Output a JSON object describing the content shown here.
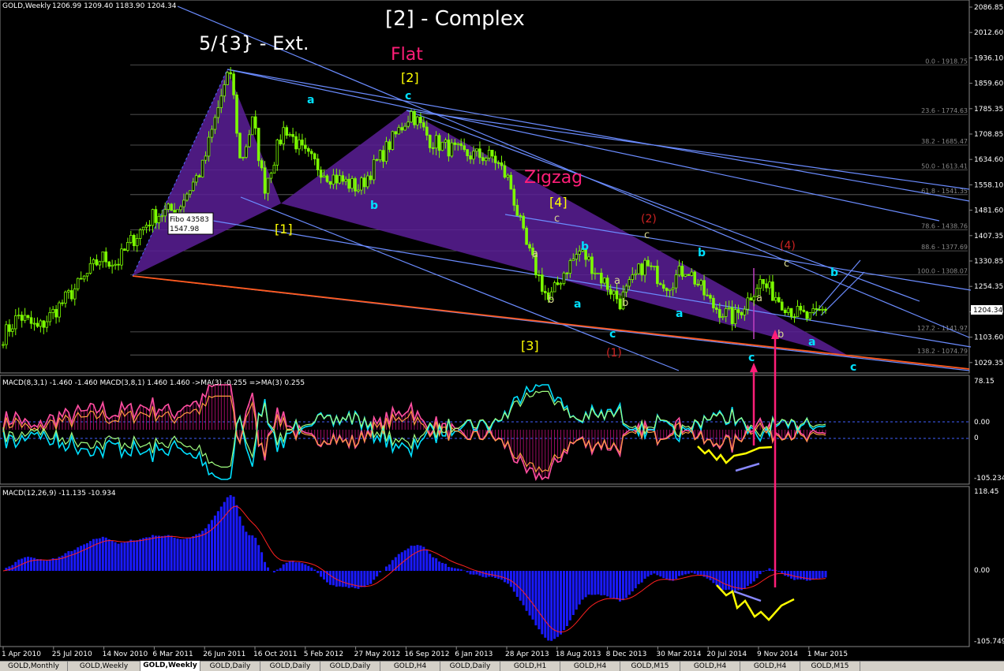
{
  "header": {
    "main": {
      "symbol": "GOLD,Weekly",
      "ohlc": "1206.99 1209.40 1183.90 1204.34"
    },
    "macd1": {
      "label": "MACD(8,3,1) -1.460 -1.460  MACD(3,8,1) 1.460 1.460  ->MA(3) -0.255  =>MA(3) 0.255"
    },
    "macd2": {
      "label": "MACD(12,26,9) -11.135 -10.934"
    }
  },
  "price_axis": {
    "ticks": [
      "2086.85",
      "2012.60",
      "1936.10",
      "1859.60",
      "1785.35",
      "1708.85",
      "1634.60",
      "1558.10",
      "1481.60",
      "1407.35",
      "1330.85",
      "1254.35",
      "1180.10",
      "1103.60",
      "1029.35"
    ],
    "current": "1204.34"
  },
  "macd1_axis": {
    "top": "78.15",
    "zero": "0.00",
    "zero2": "0",
    "bottom": "-105.234"
  },
  "macd2_axis": {
    "top": "118.45",
    "zero": "0.00",
    "bottom": "-105.749"
  },
  "fib_levels": [
    {
      "label": "0.0 - 1918.75",
      "price": 1918.75
    },
    {
      "label": "23.6 - 1774.63",
      "price": 1774.63
    },
    {
      "label": "38.2 - 1685.47",
      "price": 1685.47
    },
    {
      "label": "50.0 - 1613.41",
      "price": 1613.41
    },
    {
      "label": "61.8 - 1541.35",
      "price": 1541.35
    },
    {
      "label": "78.6 - 1438.76",
      "price": 1438.76
    },
    {
      "label": "88.6 - 1377.69",
      "price": 1377.69
    },
    {
      "label": "100.0 - 1308.07",
      "price": 1308.07
    },
    {
      "label": "127.2 - 1141.97",
      "price": 1141.97
    },
    {
      "label": "138.2 - 1074.79",
      "price": 1074.79
    }
  ],
  "fibo_box": {
    "line1": "Fibo 43583",
    "line2": "1547.98"
  },
  "date_axis": [
    "1 Apr 2010",
    "25 Jul 2010",
    "14 Nov 2010",
    "6 Mar 2011",
    "26 Jun 2011",
    "16 Oct 2011",
    "5 Feb 2012",
    "27 May 2012",
    "16 Sep 2012",
    "6 Jan 2013",
    "28 Apr 2013",
    "18 Aug 2013",
    "8 Dec 2013",
    "30 Mar 2014",
    "20 Jul 2014",
    "9 Nov 2014",
    "1 Mar 2015"
  ],
  "annotations": {
    "complex": "[2] - Complex",
    "ext": "5/{3} - Ext.",
    "flat": "Flat",
    "zigzag": "Zigzag",
    "w2": "[2]",
    "w1": "[1]",
    "w3": "[3]",
    "w4": "[4]",
    "a": "a",
    "b": "b",
    "c": "c",
    "r1": "(1)",
    "r2": "(2)",
    "r4": "(4)"
  },
  "tabs": [
    "GOLD,Monthly",
    "GOLD,Weekly",
    "GOLD,Weekly",
    "GOLD,Daily",
    "GOLD,Daily",
    "GOLD,Daily",
    "GOLD,H4",
    "GOLD,Daily",
    "GOLD,H1",
    "GOLD,H4",
    "GOLD,M15",
    "GOLD,H4",
    "GOLD,H4",
    "GOLD,M15"
  ],
  "active_tab": 2,
  "colors": {
    "candle": "#7cfc00",
    "triangle": "#5a1e96",
    "trend": "#6b8cff",
    "support": "#ff5a1e",
    "cyan": "#00e0ff",
    "yellow": "#ffff00",
    "pink": "#ff1e78",
    "red": "#cc2222",
    "hist": "#1a1aff"
  },
  "chart_data": {
    "type": "candlestick",
    "title": "GOLD,Weekly",
    "ylim": [
      1010,
      2100
    ],
    "x": [
      "1 Apr 2010",
      "25 Jul 2010",
      "14 Nov 2010",
      "6 Mar 2011",
      "26 Jun 2011",
      "16 Oct 2011",
      "5 Feb 2012",
      "27 May 2012",
      "16 Sep 2012",
      "6 Jan 2013",
      "28 Apr 2013",
      "18 Aug 2013",
      "8 Dec 2013",
      "30 Mar 2014",
      "20 Jul 2014",
      "9 Nov 2014",
      "1 Mar 2015"
    ],
    "close_path": [
      [
        "1 Apr 2010",
        1130
      ],
      [
        "25 Jul 2010",
        1190
      ],
      [
        "14 Nov 2010",
        1360
      ],
      [
        "6 Mar 2011",
        1430
      ],
      [
        "26 Jun 2011",
        1520
      ],
      [
        "Sep 2011",
        1900
      ],
      [
        "16 Oct 2011",
        1650
      ],
      [
        "Nov 2011",
        1760
      ],
      [
        "Dec 2011",
        1560
      ],
      [
        "5 Feb 2012",
        1740
      ],
      [
        "27 May 2012",
        1580
      ],
      [
        "16 Sep 2012",
        1780
      ],
      [
        "6 Jan 2013",
        1670
      ],
      [
        "28 Apr 2013",
        1400
      ],
      [
        "Jun 2013",
        1200
      ],
      [
        "18 Aug 2013",
        1400
      ],
      [
        "8 Dec 2013",
        1220
      ],
      [
        "30 Mar 2014",
        1380
      ],
      [
        "20 Jul 2014",
        1320
      ],
      [
        "9 Nov 2014",
        1140
      ],
      [
        "Jan 2015",
        1290
      ],
      [
        "1 Mar 2015",
        1170
      ],
      [
        "Mar 2015",
        1204.34
      ]
    ],
    "last": {
      "open": 1206.99,
      "high": 1209.4,
      "low": 1183.9,
      "close": 1204.34
    }
  }
}
